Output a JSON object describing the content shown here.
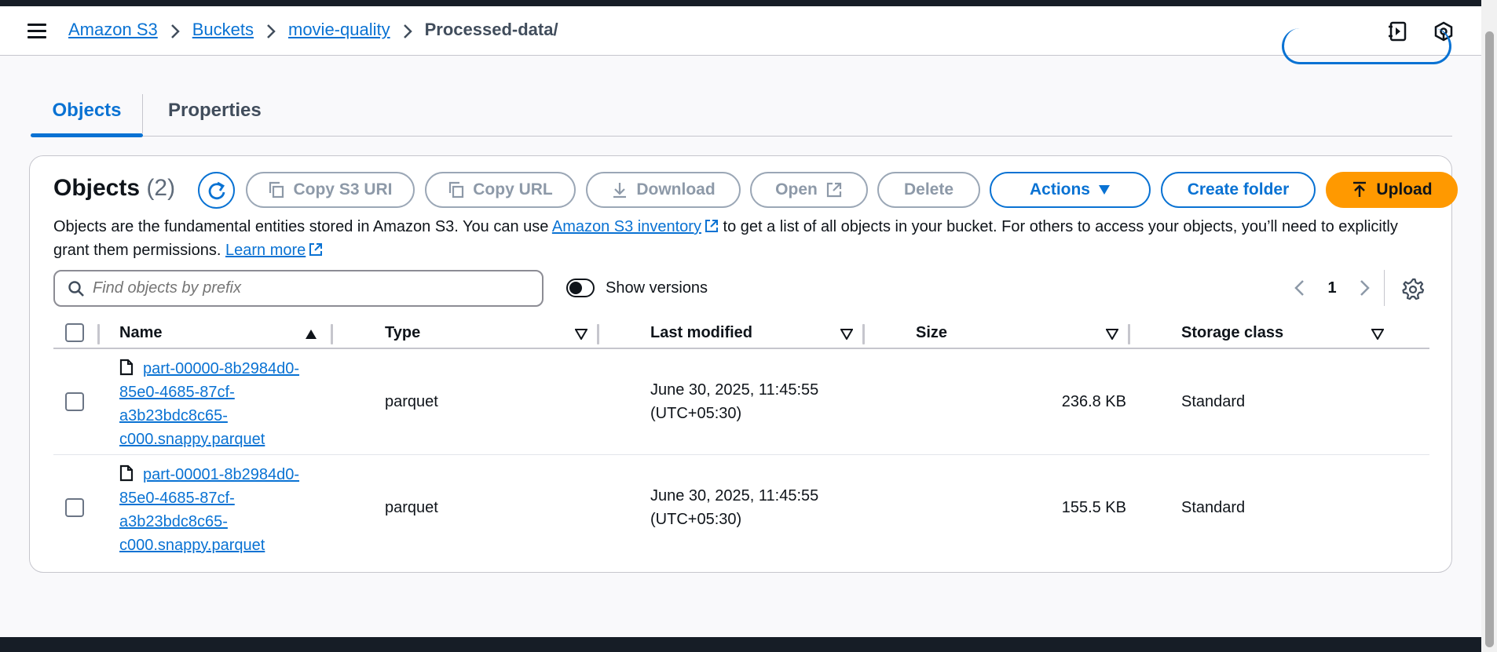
{
  "breadcrumb": {
    "items": [
      "Amazon S3",
      "Buckets",
      "movie-quality"
    ],
    "current": "Processed-data/"
  },
  "tabs": [
    {
      "label": "Objects",
      "active": true
    },
    {
      "label": "Properties",
      "active": false
    }
  ],
  "objects_panel": {
    "title": "Objects",
    "count": "(2)",
    "buttons": {
      "copy_s3_uri": "Copy S3 URI",
      "copy_url": "Copy URL",
      "download": "Download",
      "open": "Open",
      "delete": "Delete",
      "actions": "Actions",
      "create_folder": "Create folder",
      "upload": "Upload"
    },
    "description": {
      "part1": "Objects are the fundamental entities stored in Amazon S3. You can use ",
      "link1": "Amazon S3 inventory",
      "part2": " to get a list of all objects in your bucket. For others to access your objects, you’ll need to explicitly grant them permissions. ",
      "link2": "Learn more"
    },
    "search": {
      "placeholder": "Find objects by prefix",
      "value": ""
    },
    "show_versions": {
      "label": "Show versions",
      "enabled": false
    },
    "pagination": {
      "current_page": "1"
    }
  },
  "table": {
    "columns": [
      "Name",
      "Type",
      "Last modified",
      "Size",
      "Storage class"
    ],
    "rows": [
      {
        "name_lines": [
          "part-00000-8b2984d0-",
          "85e0-4685-87cf-",
          "a3b23bdc8c65-",
          "c000.snappy.parquet"
        ],
        "type": "parquet",
        "modified_line1": "June 30, 2025, 11:45:55",
        "modified_line2": "(UTC+05:30)",
        "size": "236.8 KB",
        "storage_class": "Standard"
      },
      {
        "name_lines": [
          "part-00001-8b2984d0-",
          "85e0-4685-87cf-",
          "a3b23bdc8c65-",
          "c000.snappy.parquet"
        ],
        "type": "parquet",
        "modified_line1": "June 30, 2025, 11:45:55",
        "modified_line2": "(UTC+05:30)",
        "size": "155.5 KB",
        "storage_class": "Standard"
      }
    ]
  },
  "colors": {
    "link": "#0972d3",
    "primary": "#ff9900",
    "dark": "#161d26",
    "border": "#c6c6cd"
  },
  "icons": [
    "menu-icon",
    "notebook-icon",
    "settings-hex-icon",
    "refresh-icon",
    "copy-icon",
    "download-icon",
    "external-link-icon",
    "caret-down-icon",
    "upload-icon",
    "search-icon",
    "chevron-left-icon",
    "chevron-right-icon",
    "gear-icon",
    "file-icon",
    "sort-ascending-icon",
    "sort-descending-icon"
  ]
}
